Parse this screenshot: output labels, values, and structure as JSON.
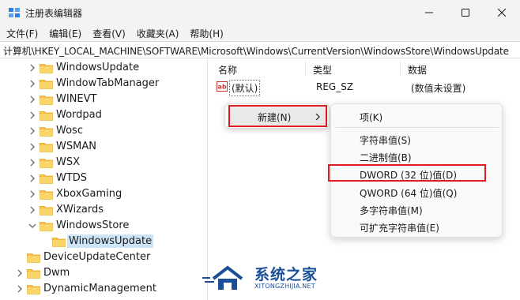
{
  "window": {
    "title": "注册表编辑器",
    "icon": "regedit-icon"
  },
  "menubar": [
    "文件(F)",
    "编辑(E)",
    "查看(V)",
    "收藏夹(A)",
    "帮助(H)"
  ],
  "address": "计算机\\HKEY_LOCAL_MACHINE\\SOFTWARE\\Microsoft\\Windows\\CurrentVersion\\WindowsStore\\WindowsUpdate",
  "tree": {
    "items": [
      {
        "label": "WindowsUpdate",
        "state": "collapsed"
      },
      {
        "label": "WindowTabManager",
        "state": "collapsed"
      },
      {
        "label": "WINEVT",
        "state": "collapsed"
      },
      {
        "label": "Wordpad",
        "state": "collapsed"
      },
      {
        "label": "Wosc",
        "state": "collapsed"
      },
      {
        "label": "WSMAN",
        "state": "collapsed"
      },
      {
        "label": "WSX",
        "state": "collapsed"
      },
      {
        "label": "WTDS",
        "state": "collapsed"
      },
      {
        "label": "XboxGaming",
        "state": "collapsed"
      },
      {
        "label": "XWizards",
        "state": "collapsed"
      },
      {
        "label": "WindowsStore",
        "state": "expanded"
      },
      {
        "label": "WindowsUpdate",
        "state": "selected"
      },
      {
        "label": "DeviceUpdateCenter",
        "state": "none"
      },
      {
        "label": "Dwm",
        "state": "collapsed"
      },
      {
        "label": "DynamicManagement",
        "state": "collapsed"
      }
    ]
  },
  "list": {
    "headers": {
      "name": "名称",
      "type": "类型",
      "data": "数据"
    },
    "rows": [
      {
        "name": "(默认)",
        "type": "REG_SZ",
        "data": "(数值未设置)"
      }
    ]
  },
  "context_menu": {
    "new_label": "新建(N)",
    "submenu": {
      "key": "项(K)",
      "items": [
        "字符串值(S)",
        "二进制值(B)",
        "DWORD (32 位)值(D)",
        "QWORD (64 位)值(Q)",
        "多字符串值(M)",
        "可扩充字符串值(E)"
      ]
    }
  },
  "watermark": {
    "main": "系统之家",
    "sub": "XITONGZHIJIA.NET"
  },
  "colors": {
    "highlight": "#e21a22",
    "selection": "#cce4f7",
    "folder": "#f5c542",
    "watermark": "#1a4f98"
  }
}
